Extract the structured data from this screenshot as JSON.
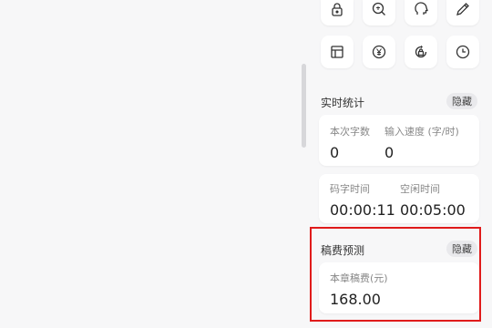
{
  "tools": {
    "row1": [
      "lock-icon",
      "search-word-icon",
      "head-icon",
      "pen-icon"
    ],
    "row2": [
      "table-icon",
      "yen-icon",
      "lock-refresh-icon",
      "clock-icon"
    ]
  },
  "realtime": {
    "title": "实时统计",
    "hide_label": "隐藏",
    "word_count_label": "本次字数",
    "word_count_value": "0",
    "speed_label": "输入速度 (字/时)",
    "speed_value": "0",
    "typing_time_label": "码字时间",
    "typing_time_value": "00:00:11",
    "idle_time_label": "空闲时间",
    "idle_time_value": "00:05:00"
  },
  "fee": {
    "title": "稿费预测",
    "hide_label": "隐藏",
    "chapter_fee_label": "本章稿费(元)",
    "chapter_fee_value": "168.00"
  },
  "colors": {
    "highlight": "#e01b1b",
    "background": "#f7f7f8",
    "card": "#ffffff"
  }
}
